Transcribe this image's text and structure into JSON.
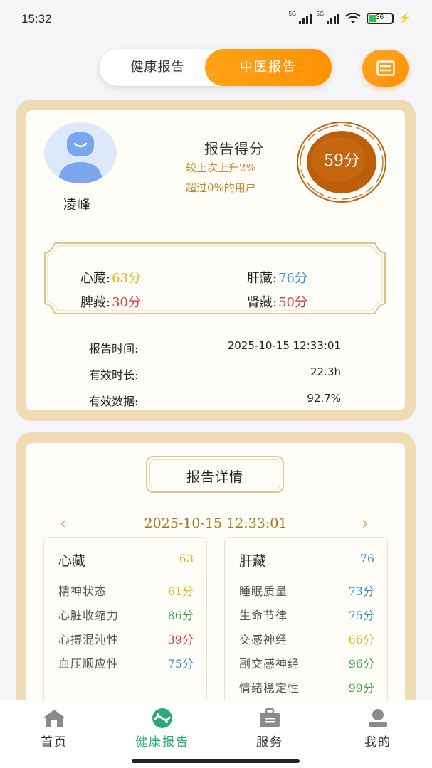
{
  "status_bar": {
    "time": "15:32",
    "net1": "5G",
    "net2": "5G",
    "battery": "36"
  },
  "toggle": {
    "health_report": "健康报告",
    "tcm_report": "中医报告"
  },
  "summary": {
    "user_name": "凌峰",
    "score_title": "报告得分",
    "score_change": "较上次上升2%",
    "score_beat": "超过0%的用户",
    "score_value": "59分",
    "organs": {
      "heart": {
        "label": "心藏:",
        "value": "63分",
        "color": "#e6b21a"
      },
      "liver": {
        "label": "肝藏:",
        "value": "76分",
        "color": "#2b8fd6"
      },
      "spleen": {
        "label": "脾藏:",
        "value": "30分",
        "color": "#d43c3c"
      },
      "kidney": {
        "label": "肾藏:",
        "value": "50分",
        "color": "#d43c3c"
      }
    },
    "info": {
      "time_label": "报告时间:",
      "time_value": "2025-10-15  12:33:01",
      "duration_label": "有效时长:",
      "duration_value": "22.3h",
      "data_label": "有效数据:",
      "data_value": "92.7%"
    }
  },
  "details": {
    "title": "报告详情",
    "date": "2025-10-15  12:33:01",
    "heart": {
      "name": "心藏",
      "score": "63",
      "metrics": [
        {
          "name": "精神状态",
          "value": "61分"
        },
        {
          "name": "心脏收缩力",
          "value": "86分"
        },
        {
          "name": "心搏混沌性",
          "value": "39分"
        },
        {
          "name": "血压顺应性",
          "value": "75分"
        }
      ]
    },
    "liver": {
      "name": "肝藏",
      "score": "76",
      "metrics": [
        {
          "name": "睡眠质量",
          "value": "73分"
        },
        {
          "name": "生命节律",
          "value": "75分"
        },
        {
          "name": "交感神经",
          "value": "66分"
        },
        {
          "name": "副交感神经",
          "value": "96分"
        },
        {
          "name": "情绪稳定性",
          "value": "99分"
        }
      ]
    }
  },
  "bottom_nav": {
    "home": "首页",
    "health": "健康报告",
    "service": "服务",
    "mine": "我的"
  },
  "icons": {
    "menu": "list-icon",
    "avatar": "user-avatar-icon",
    "home": "home-icon",
    "health": "yin-yang-icon",
    "service": "briefcase-icon",
    "mine": "user-icon",
    "prev": "chevron-left-icon",
    "next": "chevron-right-icon"
  },
  "colors": {
    "accent": "#ff9800",
    "active_nav": "#2aa97a",
    "gold": "#c08a2a",
    "card_border": "#f0dcb4"
  }
}
